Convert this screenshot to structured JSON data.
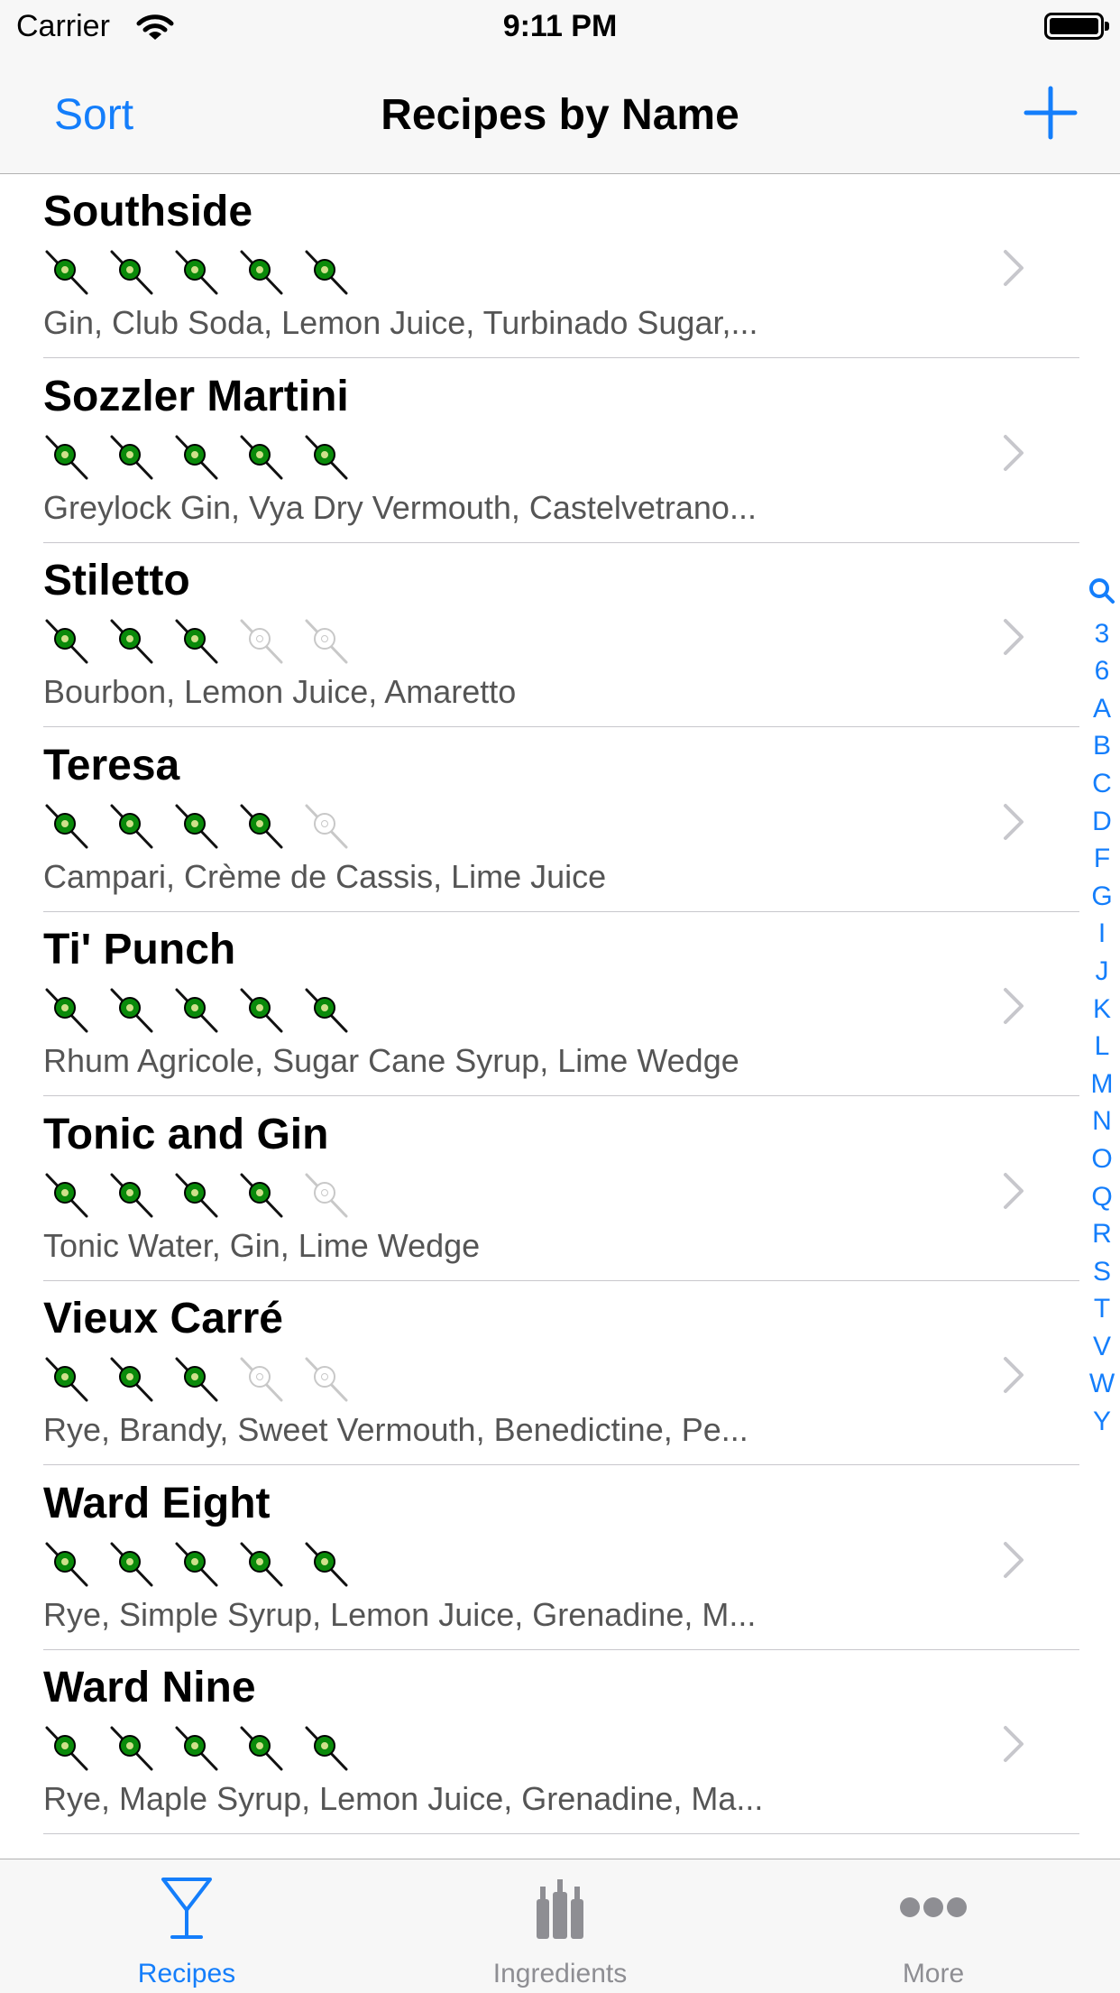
{
  "status_bar": {
    "carrier": "Carrier",
    "time": "9:11 PM",
    "battery_level": 1.0
  },
  "nav": {
    "sort_label": "Sort",
    "title": "Recipes by Name",
    "add_icon": "plus-icon"
  },
  "colors": {
    "accent": "#147efb",
    "olive_filled": "#0a8a0a",
    "olive_empty": "#c8c8c8",
    "tab_inactive": "#8e8e93"
  },
  "recipes": [
    {
      "name": "Southside",
      "rating": 5,
      "ingredients": "Gin, Club Soda, Lemon Juice, Turbinado Sugar,..."
    },
    {
      "name": "Sozzler Martini",
      "rating": 5,
      "ingredients": "Greylock Gin, Vya Dry Vermouth, Castelvetrano..."
    },
    {
      "name": "Stiletto",
      "rating": 3,
      "ingredients": "Bourbon, Lemon Juice, Amaretto"
    },
    {
      "name": "Teresa",
      "rating": 4,
      "ingredients": "Campari, Crème de Cassis, Lime Juice"
    },
    {
      "name": "Ti' Punch",
      "rating": 5,
      "ingredients": "Rhum Agricole, Sugar Cane Syrup, Lime Wedge"
    },
    {
      "name": "Tonic and Gin",
      "rating": 4,
      "ingredients": "Tonic Water, Gin, Lime Wedge"
    },
    {
      "name": "Vieux Carré",
      "rating": 3,
      "ingredients": "Rye, Brandy, Sweet Vermouth, Benedictine, Pe..."
    },
    {
      "name": "Ward Eight",
      "rating": 5,
      "ingredients": "Rye, Simple Syrup, Lemon Juice, Grenadine, M..."
    },
    {
      "name": "Ward Nine",
      "rating": 5,
      "ingredients": "Rye, Maple Syrup, Lemon Juice, Grenadine, Ma..."
    }
  ],
  "rating_max": 5,
  "section_index": [
    "search-icon",
    "3",
    "6",
    "A",
    "B",
    "C",
    "D",
    "F",
    "G",
    "I",
    "J",
    "K",
    "L",
    "M",
    "N",
    "O",
    "Q",
    "R",
    "S",
    "T",
    "V",
    "W",
    "Y"
  ],
  "tabs": [
    {
      "label": "Recipes",
      "icon": "cocktail-glass-icon",
      "selected": true
    },
    {
      "label": "Ingredients",
      "icon": "bottles-icon",
      "selected": false
    },
    {
      "label": "More",
      "icon": "more-dots-icon",
      "selected": false
    }
  ]
}
